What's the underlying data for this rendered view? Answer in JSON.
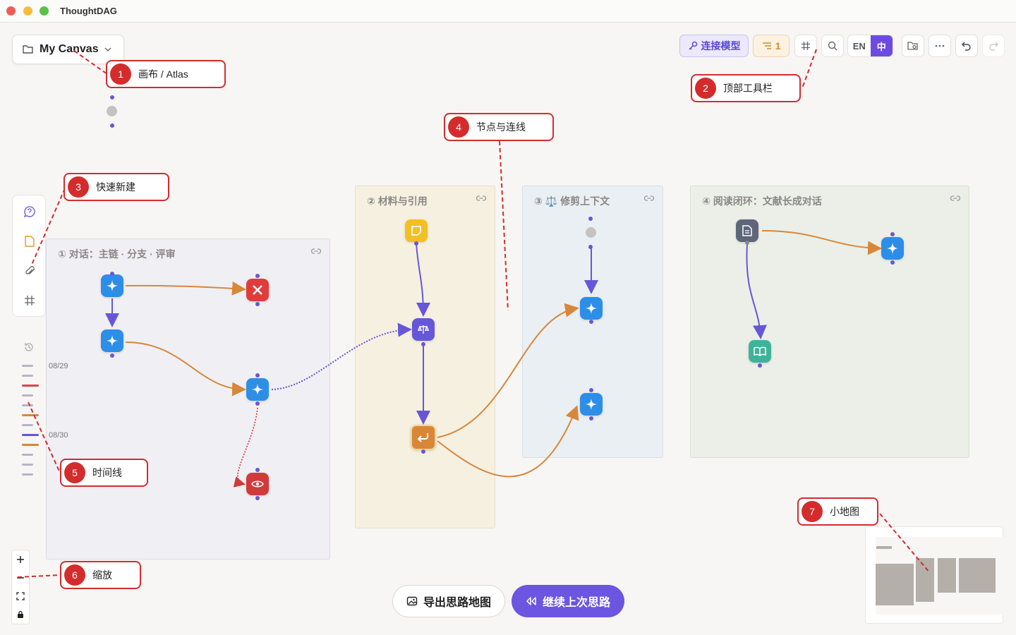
{
  "window": {
    "title": "ThoughtDAG"
  },
  "canvas_selector": {
    "label": "My Canvas"
  },
  "toolbar": {
    "connect_label": "连接模型",
    "queue_count": "1",
    "lang_en": "EN",
    "lang_zh": "中"
  },
  "groups": [
    {
      "title": "① 对话：主链 · 分支 · 评审"
    },
    {
      "title": "② 材料与引用"
    },
    {
      "title": "③ ⚖️ 修剪上下文"
    },
    {
      "title": "④ 阅读闭环：文献长成对话"
    }
  ],
  "timeline": {
    "dates": [
      "08/29",
      "08/30"
    ]
  },
  "bottom": {
    "export_label": "导出思路地图",
    "resume_label": "继续上次思路"
  },
  "callouts": [
    {
      "num": "1",
      "text": "画布 / Atlas"
    },
    {
      "num": "2",
      "text": "顶部工具栏"
    },
    {
      "num": "3",
      "text": "快速新建"
    },
    {
      "num": "4",
      "text": "节点与连线"
    },
    {
      "num": "5",
      "text": "时间线"
    },
    {
      "num": "6",
      "text": "缩放"
    },
    {
      "num": "7",
      "text": "小地图"
    }
  ],
  "colors": {
    "accent": "#6c55e0",
    "gemini_blue": "#2d8ee8",
    "reject_red": "#e03c3c",
    "note_yellow": "#f3bf22",
    "merge_orange": "#d8873a",
    "read_teal": "#3fb39a",
    "doc_slate": "#5e6679",
    "edge_orange": "#d8873a",
    "edge_purple": "#6657d8",
    "callout_red": "#d42c2c"
  }
}
